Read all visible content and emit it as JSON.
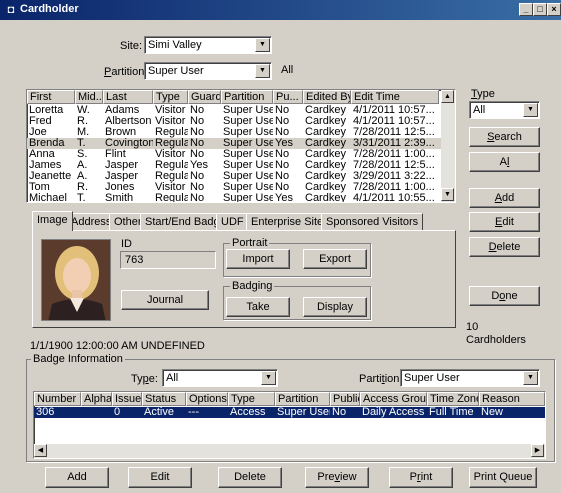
{
  "window": {
    "title": "Cardholder",
    "minimize": "_",
    "maximize": "□",
    "close": "×"
  },
  "filters": {
    "site_label": "Site:",
    "site_value": "Simi Valley",
    "partition_label_pre": "",
    "partition_label_u": "P",
    "partition_label_post": "artition:",
    "partition_value": "Super User",
    "partition_all": "All"
  },
  "cardholders": {
    "headers": [
      "First",
      "Mid...",
      "Last",
      "Type",
      "Guard",
      "Partition",
      "Pu...",
      "Edited By",
      "Edit Time"
    ],
    "rows": [
      [
        "Loretta",
        "W.",
        "Adams",
        "Visitor",
        "No",
        "Super User",
        "No",
        "Cardkey",
        "4/1/2011 10:57..."
      ],
      [
        "Fred",
        "R.",
        "Albertson",
        "Visitor",
        "No",
        "Super User",
        "No",
        "Cardkey",
        "4/1/2011 10:57..."
      ],
      [
        "Joe",
        "M.",
        "Brown",
        "Regular",
        "No",
        "Super User",
        "No",
        "Cardkey",
        "7/28/2011 12:5..."
      ],
      [
        "Brenda",
        "T.",
        "Covington",
        "Regular",
        "No",
        "Super User",
        "Yes",
        "Cardkey",
        "3/31/2011 2:39..."
      ],
      [
        "Anna",
        "S.",
        "Flint",
        "Visitor",
        "No",
        "Super User",
        "No",
        "Cardkey",
        "7/28/2011 1:00..."
      ],
      [
        "James",
        "A.",
        "Jasper",
        "Regular",
        "Yes",
        "Super User",
        "No",
        "Cardkey",
        "7/28/2011 12:5..."
      ],
      [
        "Jeanette",
        "A.",
        "Jasper",
        "Regular",
        "No",
        "Super User",
        "No",
        "Cardkey",
        "3/29/2011 3:22..."
      ],
      [
        "Tom",
        "R.",
        "Jones",
        "Visitor",
        "No",
        "Super User",
        "No",
        "Cardkey",
        "7/28/2011 1:00..."
      ],
      [
        "Michael",
        "T.",
        "Smith",
        "Regular",
        "No",
        "Super User",
        "Yes",
        "Cardkey",
        "4/1/2011 10:55..."
      ]
    ],
    "selected_row": 3
  },
  "right_panel": {
    "type_label_u": "T",
    "type_label_rest": "ype",
    "type_value": "All",
    "search_u": "S",
    "search_rest": "earch",
    "all_pre": "A",
    "all_u": "l",
    "all_post": "",
    "add_u": "A",
    "add_rest": "dd",
    "edit_u": "E",
    "edit_rest": "dit",
    "delete_u": "D",
    "delete_rest": "elete",
    "done_pre": "D",
    "done_u": "o",
    "done_post": "ne",
    "count": "10",
    "count_label": "Cardholders"
  },
  "tabs": [
    "Image",
    "Address",
    "Other",
    "Start/End Badges",
    "UDF",
    "Enterprise Sites",
    "Sponsored Visitors"
  ],
  "image_tab": {
    "id_label": "ID",
    "id_value": "763",
    "portrait_label": "Portrait",
    "import": "Import",
    "export": "Export",
    "badging_label": "Badging",
    "take": "Take",
    "display": "Display",
    "journal": "Journal"
  },
  "status_line": "1/1/1900 12:00:00 AM   UNDEFINED",
  "badge_info": {
    "title": "Badge Information",
    "type_label_pre": "Ty",
    "type_label_u": "p",
    "type_label_post": "e:",
    "type_value": "All",
    "partition_label_pre": "Parti",
    "partition_label_u": "t",
    "partition_label_post": "ion:",
    "partition_value": "Super User",
    "headers": [
      "Number",
      "Alpha",
      "Issue",
      "Status",
      "Options",
      "Type",
      "Partition",
      "Public",
      "Access Group",
      "Time Zone",
      "Reason"
    ],
    "rows": [
      [
        "306",
        "",
        "0",
        "Active",
        "---",
        "Access",
        "Super User",
        "No",
        "Daily Access",
        "Full Time",
        "New"
      ]
    ]
  },
  "bottom_buttons": {
    "add": "Add",
    "edit": "Edit",
    "delete": "Delete",
    "preview_pre": "Pre",
    "preview_u": "v",
    "preview_post": "iew",
    "print_pre": "P",
    "print_u": "r",
    "print_post": "int",
    "print_queue": "Print Queue"
  }
}
